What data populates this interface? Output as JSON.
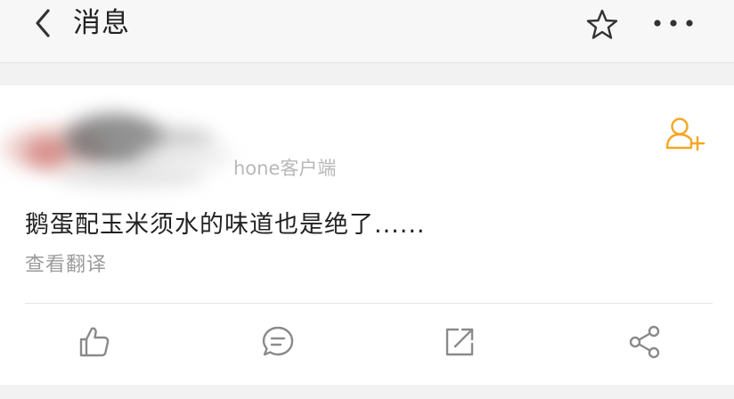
{
  "navbar": {
    "back_icon": "chevron-left-icon",
    "title": "消息",
    "favorite_icon": "star-icon",
    "more_icon": "more-dots-icon"
  },
  "post": {
    "source": "iPhone客户端",
    "source_visible": "hone客户端",
    "follow_icon": "add-user-icon",
    "text": "鹅蛋配玉米须水的味道也是绝了......",
    "translate_label": "查看翻译"
  },
  "actions": [
    {
      "icon": "thumbs-up-icon"
    },
    {
      "icon": "comment-icon"
    },
    {
      "icon": "repost-icon"
    },
    {
      "icon": "share-icon"
    }
  ],
  "colors": {
    "accent": "#f5a623",
    "icon_gray": "#8a8a8a",
    "text_primary": "#222222",
    "text_secondary": "#9b9b9b"
  }
}
